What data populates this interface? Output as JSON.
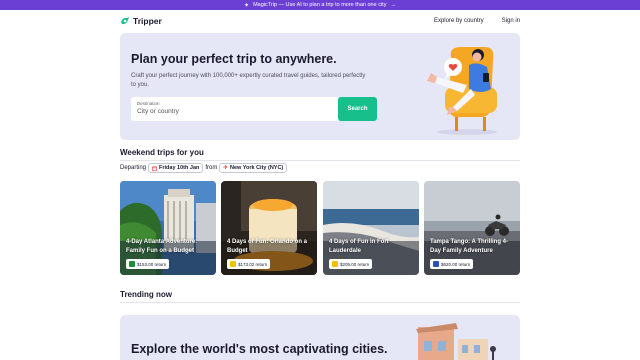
{
  "banner": {
    "text": "MagicTrip — Use AI to plan a trip to more than one city",
    "arrow": "→",
    "icon": "sparkle-icon"
  },
  "nav": {
    "logo_text": "Tripper",
    "links": [
      "Explore by country",
      "Sign in"
    ]
  },
  "hero": {
    "title": "Plan your perfect trip to anywhere.",
    "subtitle": "Craft your perfect journey with 100,000+ expertly curated travel guides, tailored perfectly to you.",
    "search_label": "Destination",
    "search_placeholder": "City or country",
    "search_button": "Search"
  },
  "weekend": {
    "title": "Weekend trips for you",
    "departing_label": "Departing",
    "date": "Friday 10th Jan",
    "from_label": "from",
    "origin": "New York City (NYC)"
  },
  "cards": [
    {
      "title": "4-Day Atlanta Adventure: Family Fun on a Budget",
      "price": "$153.00 return",
      "flag_color": "#1a8f3c"
    },
    {
      "title": "4 Days of Fun: Orlando on a Budget",
      "price": "$173.02 return",
      "flag_color": "#f2c200"
    },
    {
      "title": "4 Days of Fun in Fort Lauderdale",
      "price": "$205.00 return",
      "flag_color": "#f2c200"
    },
    {
      "title": "Tampa Tango: A Thrilling 4-Day Family Adventure",
      "price": "$620.00 return",
      "flag_color": "#2a4fbf"
    }
  ],
  "trending": {
    "title": "Trending now",
    "hero_title": "Explore the world's most captivating cities."
  },
  "colors": {
    "banner": "#6b3fd4",
    "accent": "#17c08a",
    "hero_bg": "#e6e7f6"
  }
}
